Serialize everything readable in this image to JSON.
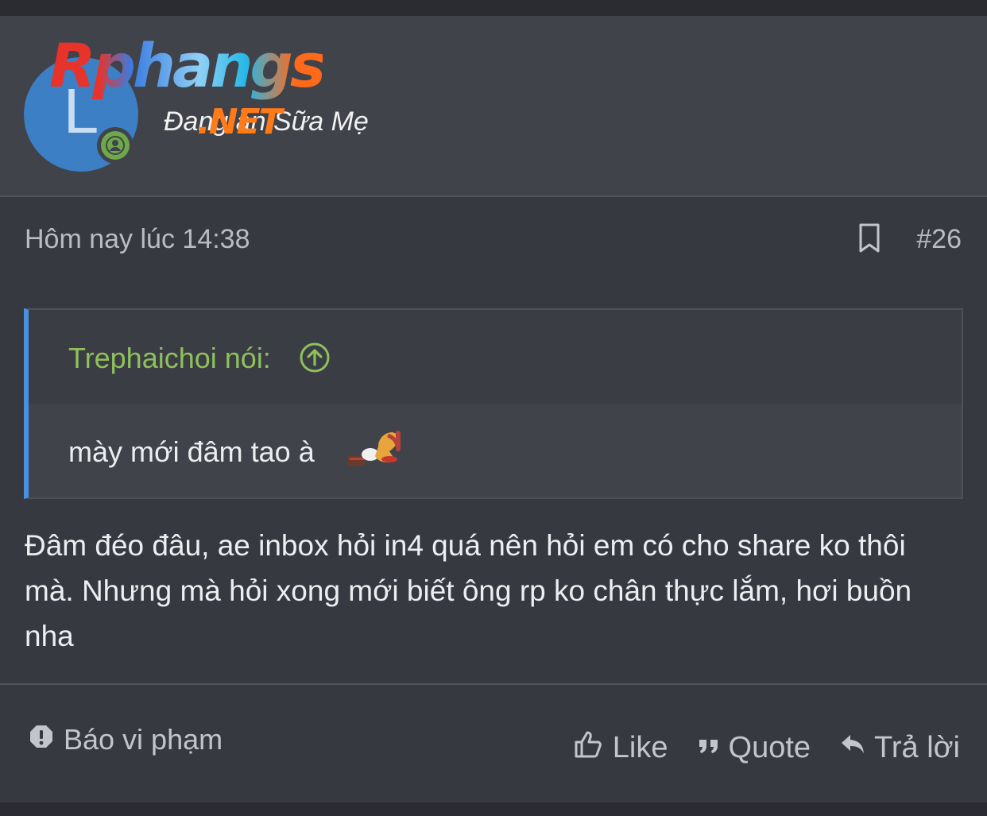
{
  "user": {
    "avatar_letter": "L",
    "logo_text": "Rphangs",
    "logo_net": ".NET",
    "tagline": "Đang ăn Sữa Mẹ"
  },
  "post": {
    "time": "Hôm nay lúc 14:38",
    "number": "#26",
    "body": "Đâm đéo đâu, ae inbox hỏi in4 quá nên hỏi em có cho share ko thôi mà. Nhưng mà hỏi xong mới biết ông rp ko chân thực lắm, hơi buồn nha"
  },
  "quote": {
    "author": "Trephaichoi nói:",
    "text": "mày mới đâm tao à"
  },
  "footer": {
    "report": "Báo vi phạm",
    "like": "Like",
    "quote": "Quote",
    "reply": "Trả lời"
  },
  "colors": {
    "accent": "#4a90e2",
    "quote_author": "#8fc05c",
    "online": "#6ea84b",
    "avatar_bg": "#3c7fc4"
  },
  "icons": [
    "bookmark-icon",
    "arrow-up-circle-icon",
    "alert-icon",
    "thumbs-up-icon",
    "quote-icon",
    "reply-icon",
    "user-icon"
  ]
}
